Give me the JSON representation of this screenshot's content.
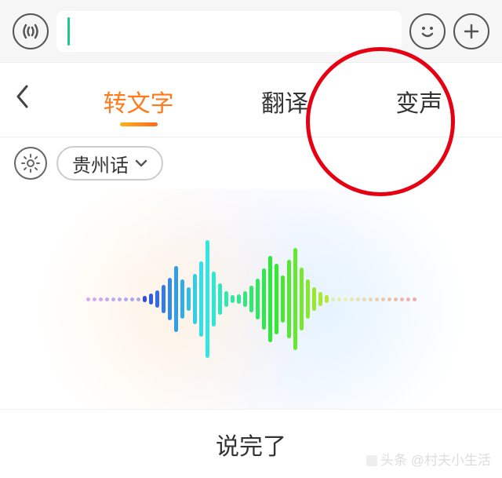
{
  "tabs": {
    "transcribe": "转文字",
    "translate": "翻译",
    "voicechange": "变声",
    "active": "transcribe"
  },
  "dialect": {
    "label": "贵州话"
  },
  "footer": {
    "done": "说完了"
  },
  "watermark": {
    "prefix": "头条",
    "author": "@村夫小生活"
  },
  "topbar": {
    "search_value": ""
  },
  "annotation": {
    "highlight_tab": "voicechange"
  }
}
